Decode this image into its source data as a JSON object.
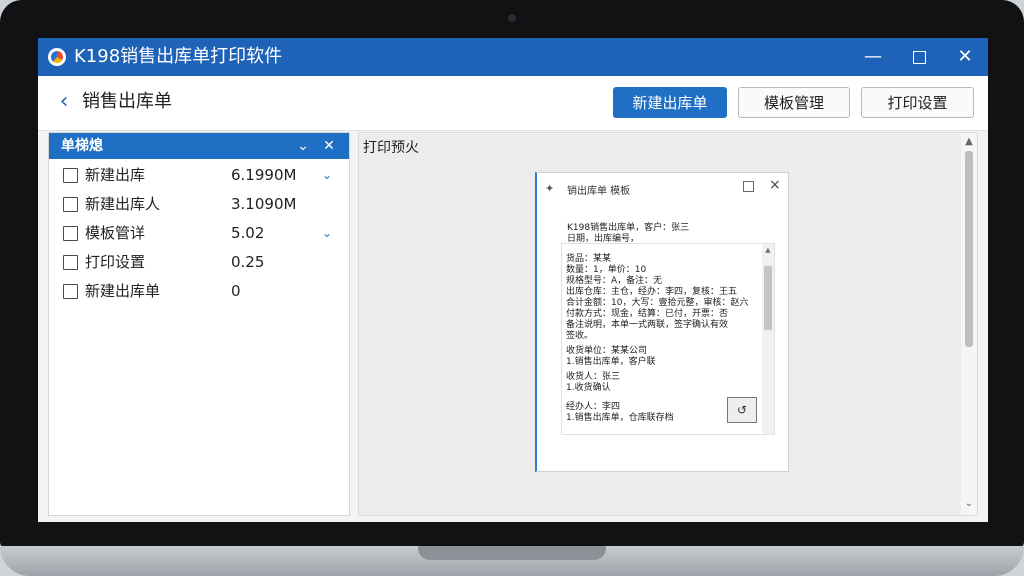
{
  "window": {
    "title": "K198销售出库单打印软件"
  },
  "toolbar": {
    "page_title": "销售出库单",
    "new_btn": "新建出库单",
    "template_btn": "模板管理",
    "print_settings_btn": "打印设置"
  },
  "left_panel": {
    "title": "单梯熄",
    "rows": [
      {
        "label": "新建出库",
        "value": "6.1990M",
        "expand": true
      },
      {
        "label": "新建出库人",
        "value": "3.1090M",
        "expand": false
      },
      {
        "label": "模板管详",
        "value": "5.02",
        "expand": true
      },
      {
        "label": "打印设置",
        "value": "0.25",
        "expand": false
      },
      {
        "label": "新建出库单",
        "value": "0",
        "expand": false
      }
    ]
  },
  "preview": {
    "label": "打印预火",
    "doc_title": "销出库单 模板",
    "doc_lines": [
      "K198销售出库单，客户：张三",
      "日期，出库编号，",
      "货品：某某",
      "数量：1，单价：10",
      "规格型号：A，备注：无",
      "出库仓库：主仓，经办：李四，复核：王五",
      "合计金额：10，大写：壹拾元整，审核：赵六",
      "付款方式：现金，结算：已付，开票：否",
      "备注说明，本单一式两联，签字确认有效",
      "签收。",
      "收货单位：某某公司",
      "1.销售出库单，客户联",
      "收货人：张三",
      "1.收货确认",
      "经办人：李四",
      "1.销售出库单，仓库联存档"
    ]
  },
  "icons": {
    "app": "app-logo-icon",
    "back": "back-arrow-icon",
    "collapse": "chevron-down-icon",
    "close": "close-icon"
  }
}
